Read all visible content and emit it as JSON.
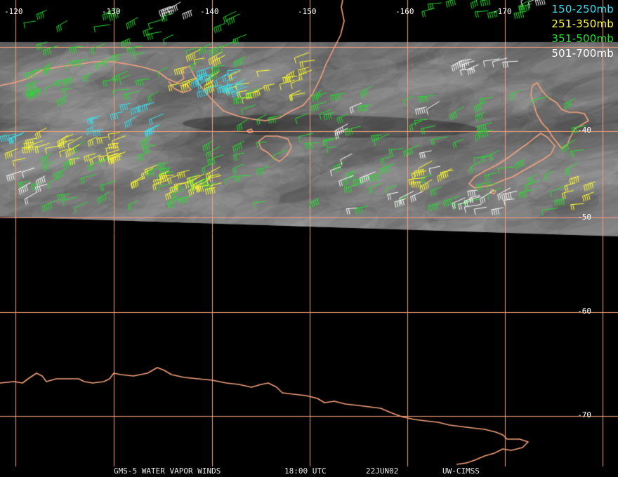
{
  "grid": {
    "line_color": "#f4a17d",
    "longitudes": [
      "-120",
      "-130",
      "-140",
      "-150",
      "-160",
      "-170"
    ],
    "latitudes": [
      "-40",
      "-50",
      "-60",
      "-70"
    ]
  },
  "legend": {
    "items": [
      {
        "label": "150-250mb",
        "color": "#38e0f0"
      },
      {
        "label": "251-350mb",
        "color": "#ffff2a"
      },
      {
        "label": "351-500mb",
        "color": "#23e02d"
      },
      {
        "label": "501-700mb",
        "color": "#ffffff"
      }
    ]
  },
  "colors": {
    "coastline": "#f4a17d",
    "background": "#000000"
  },
  "footer": {
    "product": "GMS-5 WATER VAPOR WINDS",
    "time": "18:00 UTC",
    "date": "22JUN02",
    "source": "UW-CIMSS"
  }
}
